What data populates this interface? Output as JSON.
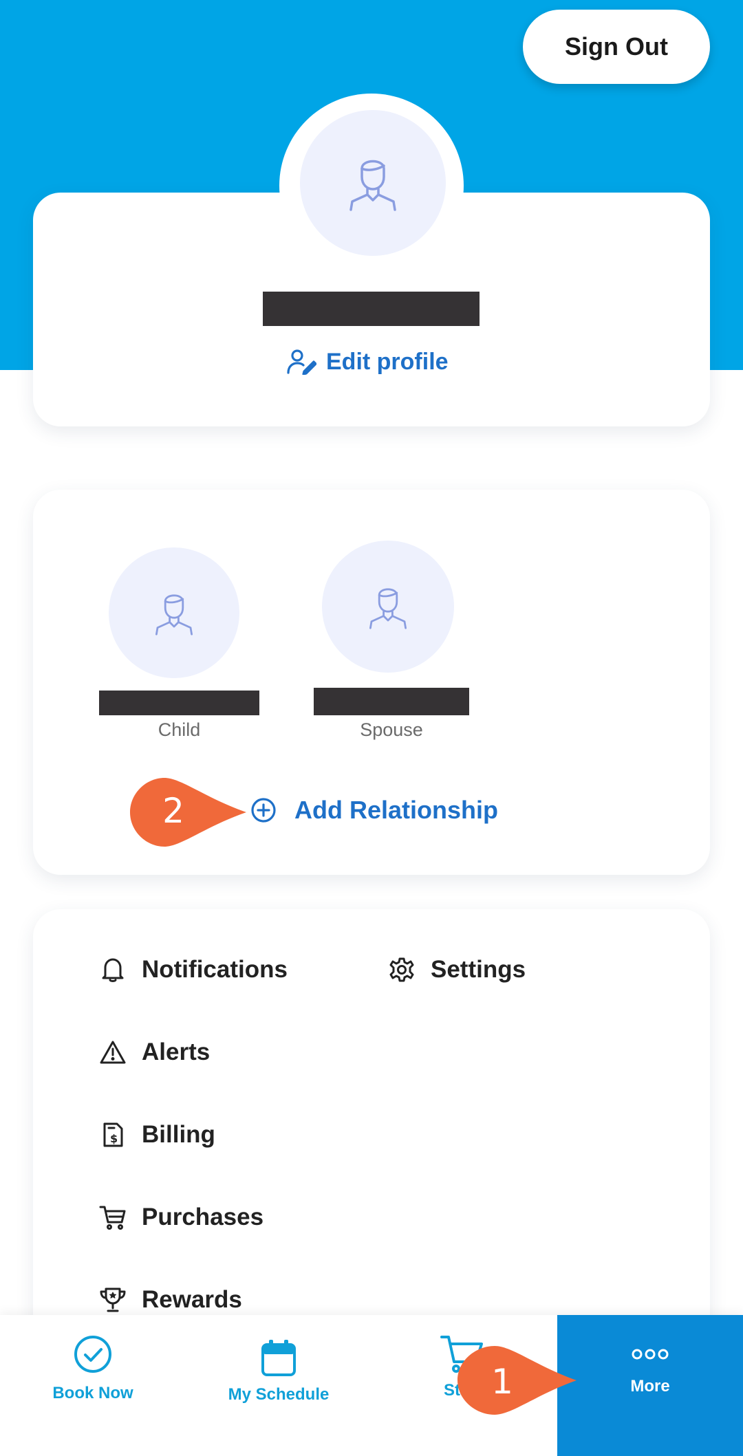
{
  "header": {
    "sign_out_label": "Sign Out",
    "accent_color": "#00a5e6"
  },
  "profile": {
    "edit_profile_label": "Edit profile"
  },
  "relationships": {
    "members": [
      {
        "role": "Child"
      },
      {
        "role": "Spouse"
      }
    ],
    "add_label": "Add Relationship"
  },
  "menu": {
    "items": [
      {
        "label": "Notifications",
        "icon": "bell-icon"
      },
      {
        "label": "Settings",
        "icon": "gear-icon"
      },
      {
        "label": "Alerts",
        "icon": "warning-icon"
      },
      {
        "label": "Billing",
        "icon": "invoice-icon"
      },
      {
        "label": "Purchases",
        "icon": "cart-icon"
      },
      {
        "label": "Rewards",
        "icon": "trophy-icon"
      }
    ]
  },
  "bottom_nav": {
    "items": [
      {
        "label": "Book Now",
        "icon": "check-circle-icon"
      },
      {
        "label": "My Schedule",
        "icon": "calendar-icon"
      },
      {
        "label": "St",
        "icon": "cart-icon"
      },
      {
        "label": "More",
        "icon": "dots-icon"
      }
    ]
  },
  "callouts": {
    "first": "1",
    "second": "2",
    "color": "#f0693a"
  }
}
